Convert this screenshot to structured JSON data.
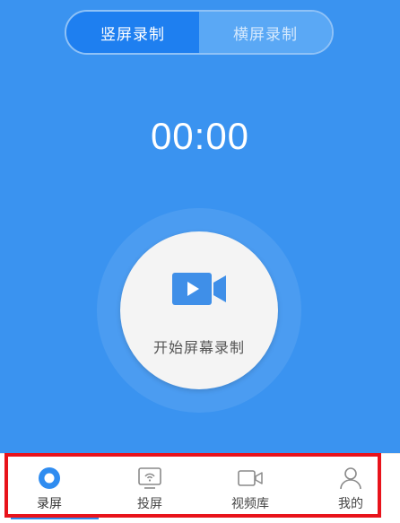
{
  "segmented": {
    "portrait_label": "竖屏录制",
    "landscape_label": "横屏录制"
  },
  "timer": "00:00",
  "record_button": {
    "label": "开始屏幕录制",
    "icon": "video-camera-icon"
  },
  "tabs": [
    {
      "label": "录屏",
      "icon": "record-icon",
      "active": true
    },
    {
      "label": "投屏",
      "icon": "cast-icon",
      "active": false
    },
    {
      "label": "视频库",
      "icon": "video-library-icon",
      "active": false
    },
    {
      "label": "我的",
      "icon": "user-icon",
      "active": false
    }
  ],
  "colors": {
    "background": "#3a93f0",
    "segment_active": "#1e7ff0",
    "accent": "#2f8cf0",
    "highlight_box": "#e8131b"
  }
}
